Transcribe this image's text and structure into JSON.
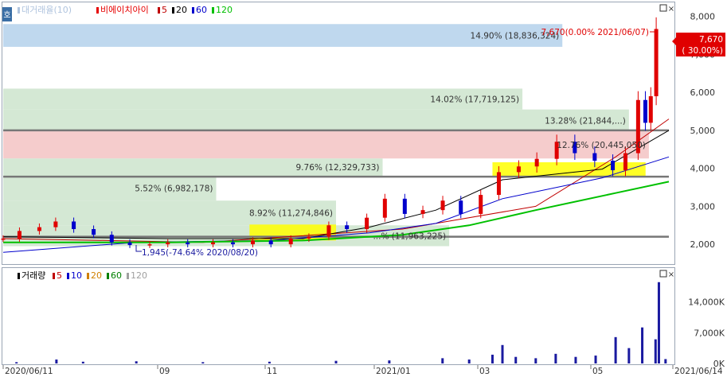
{
  "legend_top": [
    {
      "label": "대거래율(10)",
      "color": "#b0c4de"
    },
    {
      "label": "비에이치아이",
      "color": "#e60000"
    },
    {
      "label": "5",
      "color": "#c00000"
    },
    {
      "label": "20",
      "color": "#000000"
    },
    {
      "label": "60",
      "color": "#0000cc"
    },
    {
      "label": "120",
      "color": "#00c000"
    }
  ],
  "legend_bottom": [
    {
      "label": "거래량",
      "color": "#000000"
    },
    {
      "label": "5",
      "color": "#c00000"
    },
    {
      "label": "10",
      "color": "#0000cc"
    },
    {
      "label": "20",
      "color": "#d08000"
    },
    {
      "label": "60",
      "color": "#008000"
    },
    {
      "label": "120",
      "color": "#a0a0a0"
    }
  ],
  "side_tab": "호",
  "price_axis": {
    "min": 1500,
    "max": 8350,
    "ticks": [
      "8,000",
      "7,000",
      "6,000",
      "5,000",
      "4,000",
      "3,000",
      "2,000"
    ],
    "tick_values": [
      8000,
      7000,
      6000,
      5000,
      4000,
      3000,
      2000
    ]
  },
  "volume_axis": {
    "min": 0,
    "max": 19000,
    "ticks": [
      "14,000K",
      "7,000K",
      "0K"
    ],
    "tick_values": [
      14000,
      7000,
      0
    ]
  },
  "date_labels": [
    "2020/06/11",
    "09",
    "11",
    "2021/01",
    "03",
    "05",
    "2021/06/14"
  ],
  "current_price": {
    "line1": "7,670",
    "line2": "( 30.00%)"
  },
  "high_annotation": "7,670(0.00% 2021/06/07)",
  "low_annotation": "1,945(-74.64% 2020/08/20)",
  "volume_profile": [
    {
      "label": "14.90% (18,836,324)",
      "low": 7200,
      "high": 7800,
      "color": "#b8d4ec"
    },
    {
      "label": "14.02% (17,719,125)",
      "low": 5550,
      "high": 6100,
      "color": "#cfe6cf"
    },
    {
      "label": "13.28% (21,844,...)",
      "low": 4980,
      "high": 5550,
      "color": "#cfe6cf"
    },
    {
      "label": "12.76% (20,445,050)",
      "low": 4260,
      "high": 4980,
      "color": "#f4c6c6"
    },
    {
      "label": "9.76% (12,329,733)",
      "low": 3800,
      "high": 4260,
      "color": "#cfe6cf"
    },
    {
      "label": "5.52% (6,982,178)",
      "low": 3150,
      "high": 3800,
      "color": "#cfe6cf"
    },
    {
      "label": "8.92% (11,274,846)",
      "low": 2500,
      "high": 3150,
      "color": "#cfe6cf"
    },
    {
      "label": "...% (11,963,225)",
      "low": 1950,
      "high": 2500,
      "color": "#cfe6cf"
    }
  ],
  "horizontal_lines": [
    5000,
    3780,
    2200
  ],
  "highlight_zones": [
    {
      "x0": 0.37,
      "x1": 0.5,
      "low": 2100,
      "high": 2520
    },
    {
      "x0": 0.735,
      "x1": 0.965,
      "low": 3780,
      "high": 4160
    }
  ],
  "chart_data": {
    "type": "candlestick",
    "series_name": "비에이치아이",
    "x_range": [
      "2020/06/11",
      "2021/06/14"
    ],
    "ohlc_close_path": [
      [
        "2020/06/11",
        2150
      ],
      [
        "2020/06/20",
        2350
      ],
      [
        "2020/07/01",
        2450
      ],
      [
        "2020/07/10",
        2600
      ],
      [
        "2020/07/20",
        2400
      ],
      [
        "2020/07/31",
        2250
      ],
      [
        "2020/08/10",
        2050
      ],
      [
        "2020/08/20",
        1980
      ],
      [
        "2020/08/31",
        2000
      ],
      [
        "2020/09/10",
        2050
      ],
      [
        "2020/09/21",
        2000
      ],
      [
        "2020/10/05",
        2050
      ],
      [
        "2020/10/16",
        2000
      ],
      [
        "2020/10/27",
        2100
      ],
      [
        "2020/11/06",
        2000
      ],
      [
        "2020/11/17",
        2150
      ],
      [
        "2020/11/27",
        2200
      ],
      [
        "2020/12/08",
        2500
      ],
      [
        "2020/12/18",
        2400
      ],
      [
        "2020/12/29",
        2700
      ],
      [
        "2021/01/08",
        3200
      ],
      [
        "2021/01/19",
        2800
      ],
      [
        "2021/01/29",
        2900
      ],
      [
        "2021/02/09",
        3150
      ],
      [
        "2021/02/19",
        2800
      ],
      [
        "2021/03/02",
        3300
      ],
      [
        "2021/03/12",
        3900
      ],
      [
        "2021/03/23",
        4050
      ],
      [
        "2021/04/02",
        4250
      ],
      [
        "2021/04/13",
        4700
      ],
      [
        "2021/04/23",
        4400
      ],
      [
        "2021/05/04",
        4200
      ],
      [
        "2021/05/14",
        3950
      ],
      [
        "2021/05/21",
        4400
      ],
      [
        "2021/05/28",
        5800
      ],
      [
        "2021/06/01",
        5200
      ],
      [
        "2021/06/04",
        5900
      ],
      [
        "2021/06/07",
        7670
      ]
    ],
    "ma": [
      {
        "name": "5",
        "color": "#c00000",
        "points": [
          [
            0.0,
            2150
          ],
          [
            0.3,
            2050
          ],
          [
            0.6,
            2400
          ],
          [
            0.8,
            3000
          ],
          [
            0.92,
            4300
          ],
          [
            1.0,
            5300
          ]
        ]
      },
      {
        "name": "20",
        "color": "#000000",
        "points": [
          [
            0.0,
            2200
          ],
          [
            0.25,
            2150
          ],
          [
            0.45,
            2150
          ],
          [
            0.55,
            2450
          ],
          [
            0.65,
            2900
          ],
          [
            0.75,
            3700
          ],
          [
            0.9,
            3980
          ],
          [
            1.0,
            5000
          ]
        ]
      },
      {
        "name": "60",
        "color": "#0000cc",
        "points": [
          [
            0.0,
            1790
          ],
          [
            0.2,
            2050
          ],
          [
            0.4,
            2100
          ],
          [
            0.55,
            2300
          ],
          [
            0.65,
            2550
          ],
          [
            0.75,
            3200
          ],
          [
            0.9,
            3750
          ],
          [
            1.0,
            4300
          ]
        ]
      },
      {
        "name": "120",
        "color": "#00c000",
        "points": [
          [
            0.0,
            2050
          ],
          [
            0.25,
            2050
          ],
          [
            0.45,
            2100
          ],
          [
            0.6,
            2250
          ],
          [
            0.7,
            2500
          ],
          [
            0.8,
            2900
          ],
          [
            0.92,
            3350
          ],
          [
            1.0,
            3650
          ]
        ]
      }
    ],
    "volume_K": [
      [
        0.02,
        300
      ],
      [
        0.08,
        900
      ],
      [
        0.12,
        400
      ],
      [
        0.2,
        500
      ],
      [
        0.3,
        300
      ],
      [
        0.4,
        400
      ],
      [
        0.5,
        600
      ],
      [
        0.58,
        700
      ],
      [
        0.66,
        1200
      ],
      [
        0.7,
        900
      ],
      [
        0.735,
        2000
      ],
      [
        0.75,
        4200
      ],
      [
        0.77,
        1500
      ],
      [
        0.8,
        1200
      ],
      [
        0.83,
        2200
      ],
      [
        0.86,
        1500
      ],
      [
        0.89,
        1800
      ],
      [
        0.92,
        6000
      ],
      [
        0.94,
        3500
      ],
      [
        0.96,
        8200
      ],
      [
        0.98,
        5500
      ],
      [
        0.985,
        18500
      ],
      [
        0.995,
        1000
      ]
    ]
  }
}
